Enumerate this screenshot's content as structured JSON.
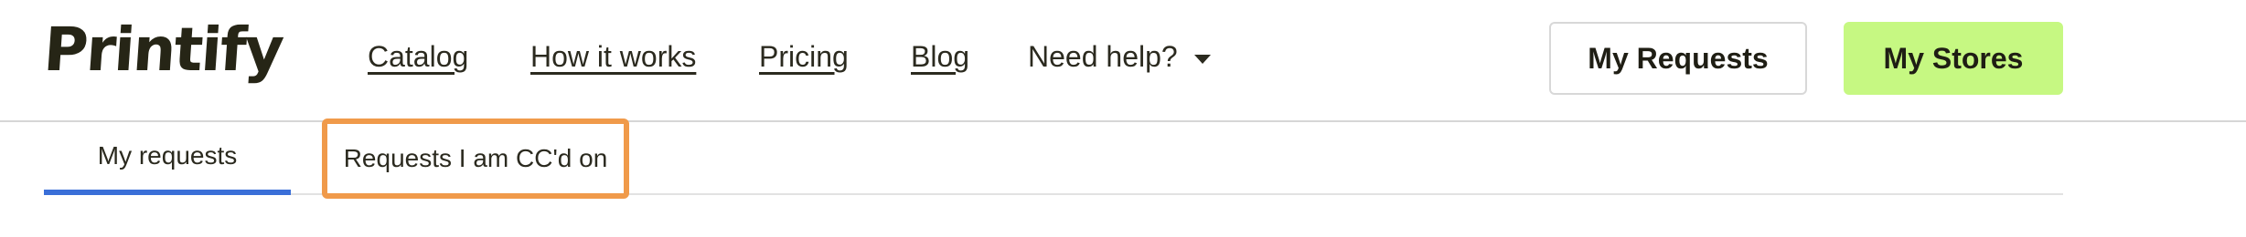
{
  "header": {
    "logo_text": "Printify",
    "nav": {
      "catalog": "Catalog",
      "how_it_works": "How it works",
      "pricing": "Pricing",
      "blog": "Blog",
      "need_help": "Need help?"
    },
    "buttons": {
      "my_requests": "My Requests",
      "my_stores": "My Stores"
    }
  },
  "tabs": {
    "my_requests": "My requests",
    "cc_requests": "Requests I am CC'd on"
  },
  "colors": {
    "accent_green": "#c6f882",
    "active_tab_blue": "#3a6fd8",
    "highlight_orange": "#f09a4a"
  }
}
